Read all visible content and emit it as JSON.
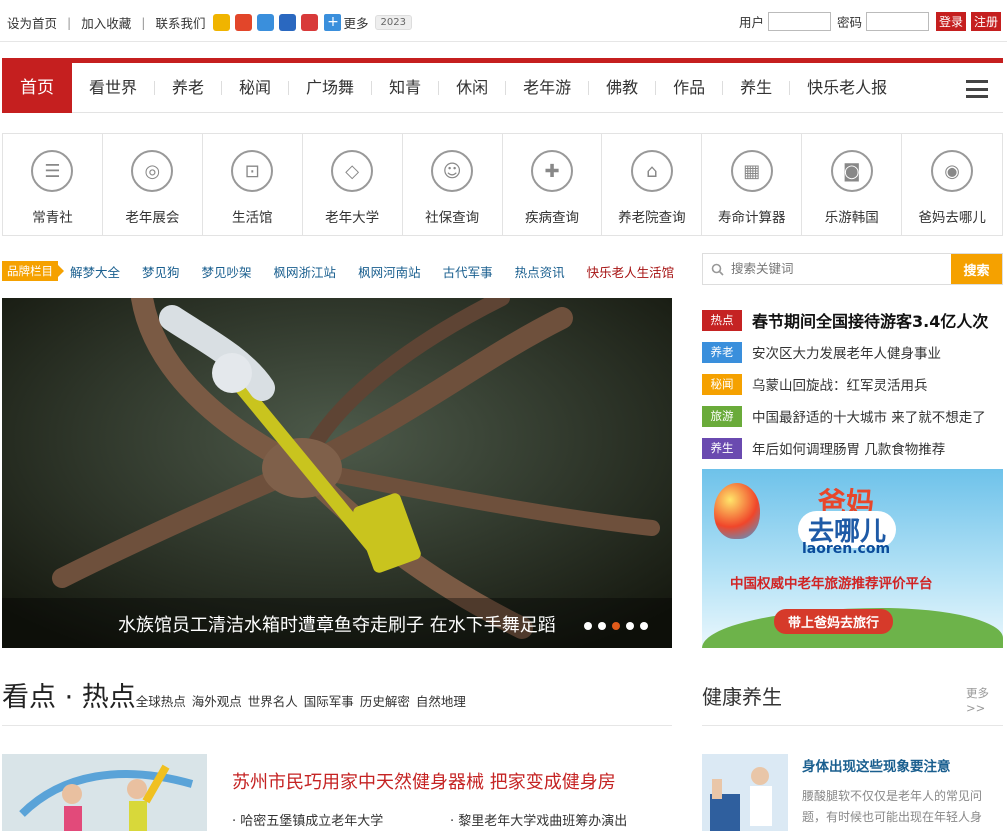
{
  "topbar": {
    "set_home": "设为首页",
    "bookmark": "加入收藏",
    "contact": "联系我们",
    "more": "更多",
    "year_badge": "2023",
    "user_label": "用户",
    "password_label": "密码",
    "login": "登录",
    "register": "注册",
    "social_colors": [
      "#f0b400",
      "#e2462a",
      "#3a8fdc",
      "#2a68c0",
      "#d83a3a"
    ]
  },
  "nav": {
    "home": "首页",
    "items": [
      "看世界",
      "养老",
      "秘闻",
      "广场舞",
      "知青",
      "休闲",
      "老年游",
      "佛教",
      "作品",
      "养生",
      "快乐老人报"
    ]
  },
  "services": [
    {
      "label": "常青社",
      "icon": "chat-icon"
    },
    {
      "label": "老年展会",
      "icon": "globe-icon"
    },
    {
      "label": "生活馆",
      "icon": "cart-icon"
    },
    {
      "label": "老年大学",
      "icon": "graduation-cap-icon"
    },
    {
      "label": "社保查询",
      "icon": "user-plus-icon"
    },
    {
      "label": "疾病查询",
      "icon": "medical-kit-icon"
    },
    {
      "label": "养老院查询",
      "icon": "home-heart-icon"
    },
    {
      "label": "寿命计算器",
      "icon": "calculator-icon"
    },
    {
      "label": "乐游韩国",
      "icon": "camera-icon"
    },
    {
      "label": "爸妈去哪儿",
      "icon": "location-icon"
    }
  ],
  "brand": {
    "tag": "品牌栏目",
    "links": [
      "解梦大全",
      "梦见狗",
      "梦见吵架",
      "枫网浙江站",
      "枫网河南站",
      "古代军事",
      "热点资讯",
      "快乐老人生活馆"
    ]
  },
  "search": {
    "placeholder": "搜索关键词",
    "button": "搜索"
  },
  "slideshow": {
    "caption": "水族馆员工清洁水箱时遭章鱼夺走刷子 在水下手舞足蹈",
    "active_dot": 3,
    "dot_count": 5
  },
  "news": [
    {
      "tag": "热点",
      "color": "#c52323",
      "title": "春节期间全国接待游客3.4亿人次"
    },
    {
      "tag": "养老",
      "color": "#3a8fdc",
      "title": "安次区大力发展老年人健身事业"
    },
    {
      "tag": "秘闻",
      "color": "#f5a100",
      "title": "乌蒙山回旋战：红军灵活用兵"
    },
    {
      "tag": "旅游",
      "color": "#6aab3a",
      "title": "中国最舒适的十大城市 来了就不想走了"
    },
    {
      "tag": "养生",
      "color": "#6a4ab0",
      "title": "年后如何调理肠胃 几款食物推荐"
    }
  ],
  "ad": {
    "line1": "爸妈",
    "line2": "去哪儿",
    "domain": "laoren.com",
    "slogan": "中国权威中老年旅游推荐评价平台",
    "cta": "带上爸妈去旅行"
  },
  "section": {
    "title": "看点 · 热点",
    "links": [
      "全球热点",
      "海外观点",
      "世界名人",
      "国际军事",
      "历史解密",
      "自然地理"
    ],
    "health_title": "健康养生",
    "health_more": "更多>>"
  },
  "feature": {
    "headline": "苏州市民巧用家中天然健身器械 把家变成健身房",
    "sub1": "· 哈密五堡镇成立老年大学",
    "sub2": "· 黎里老年大学戏曲班筹办演出"
  },
  "health_item": {
    "title": "身体出现这些现象要注意",
    "desc": "腰酸腿软不仅仅是老年人的常见问题，有时候也可能出现在年轻人身"
  }
}
